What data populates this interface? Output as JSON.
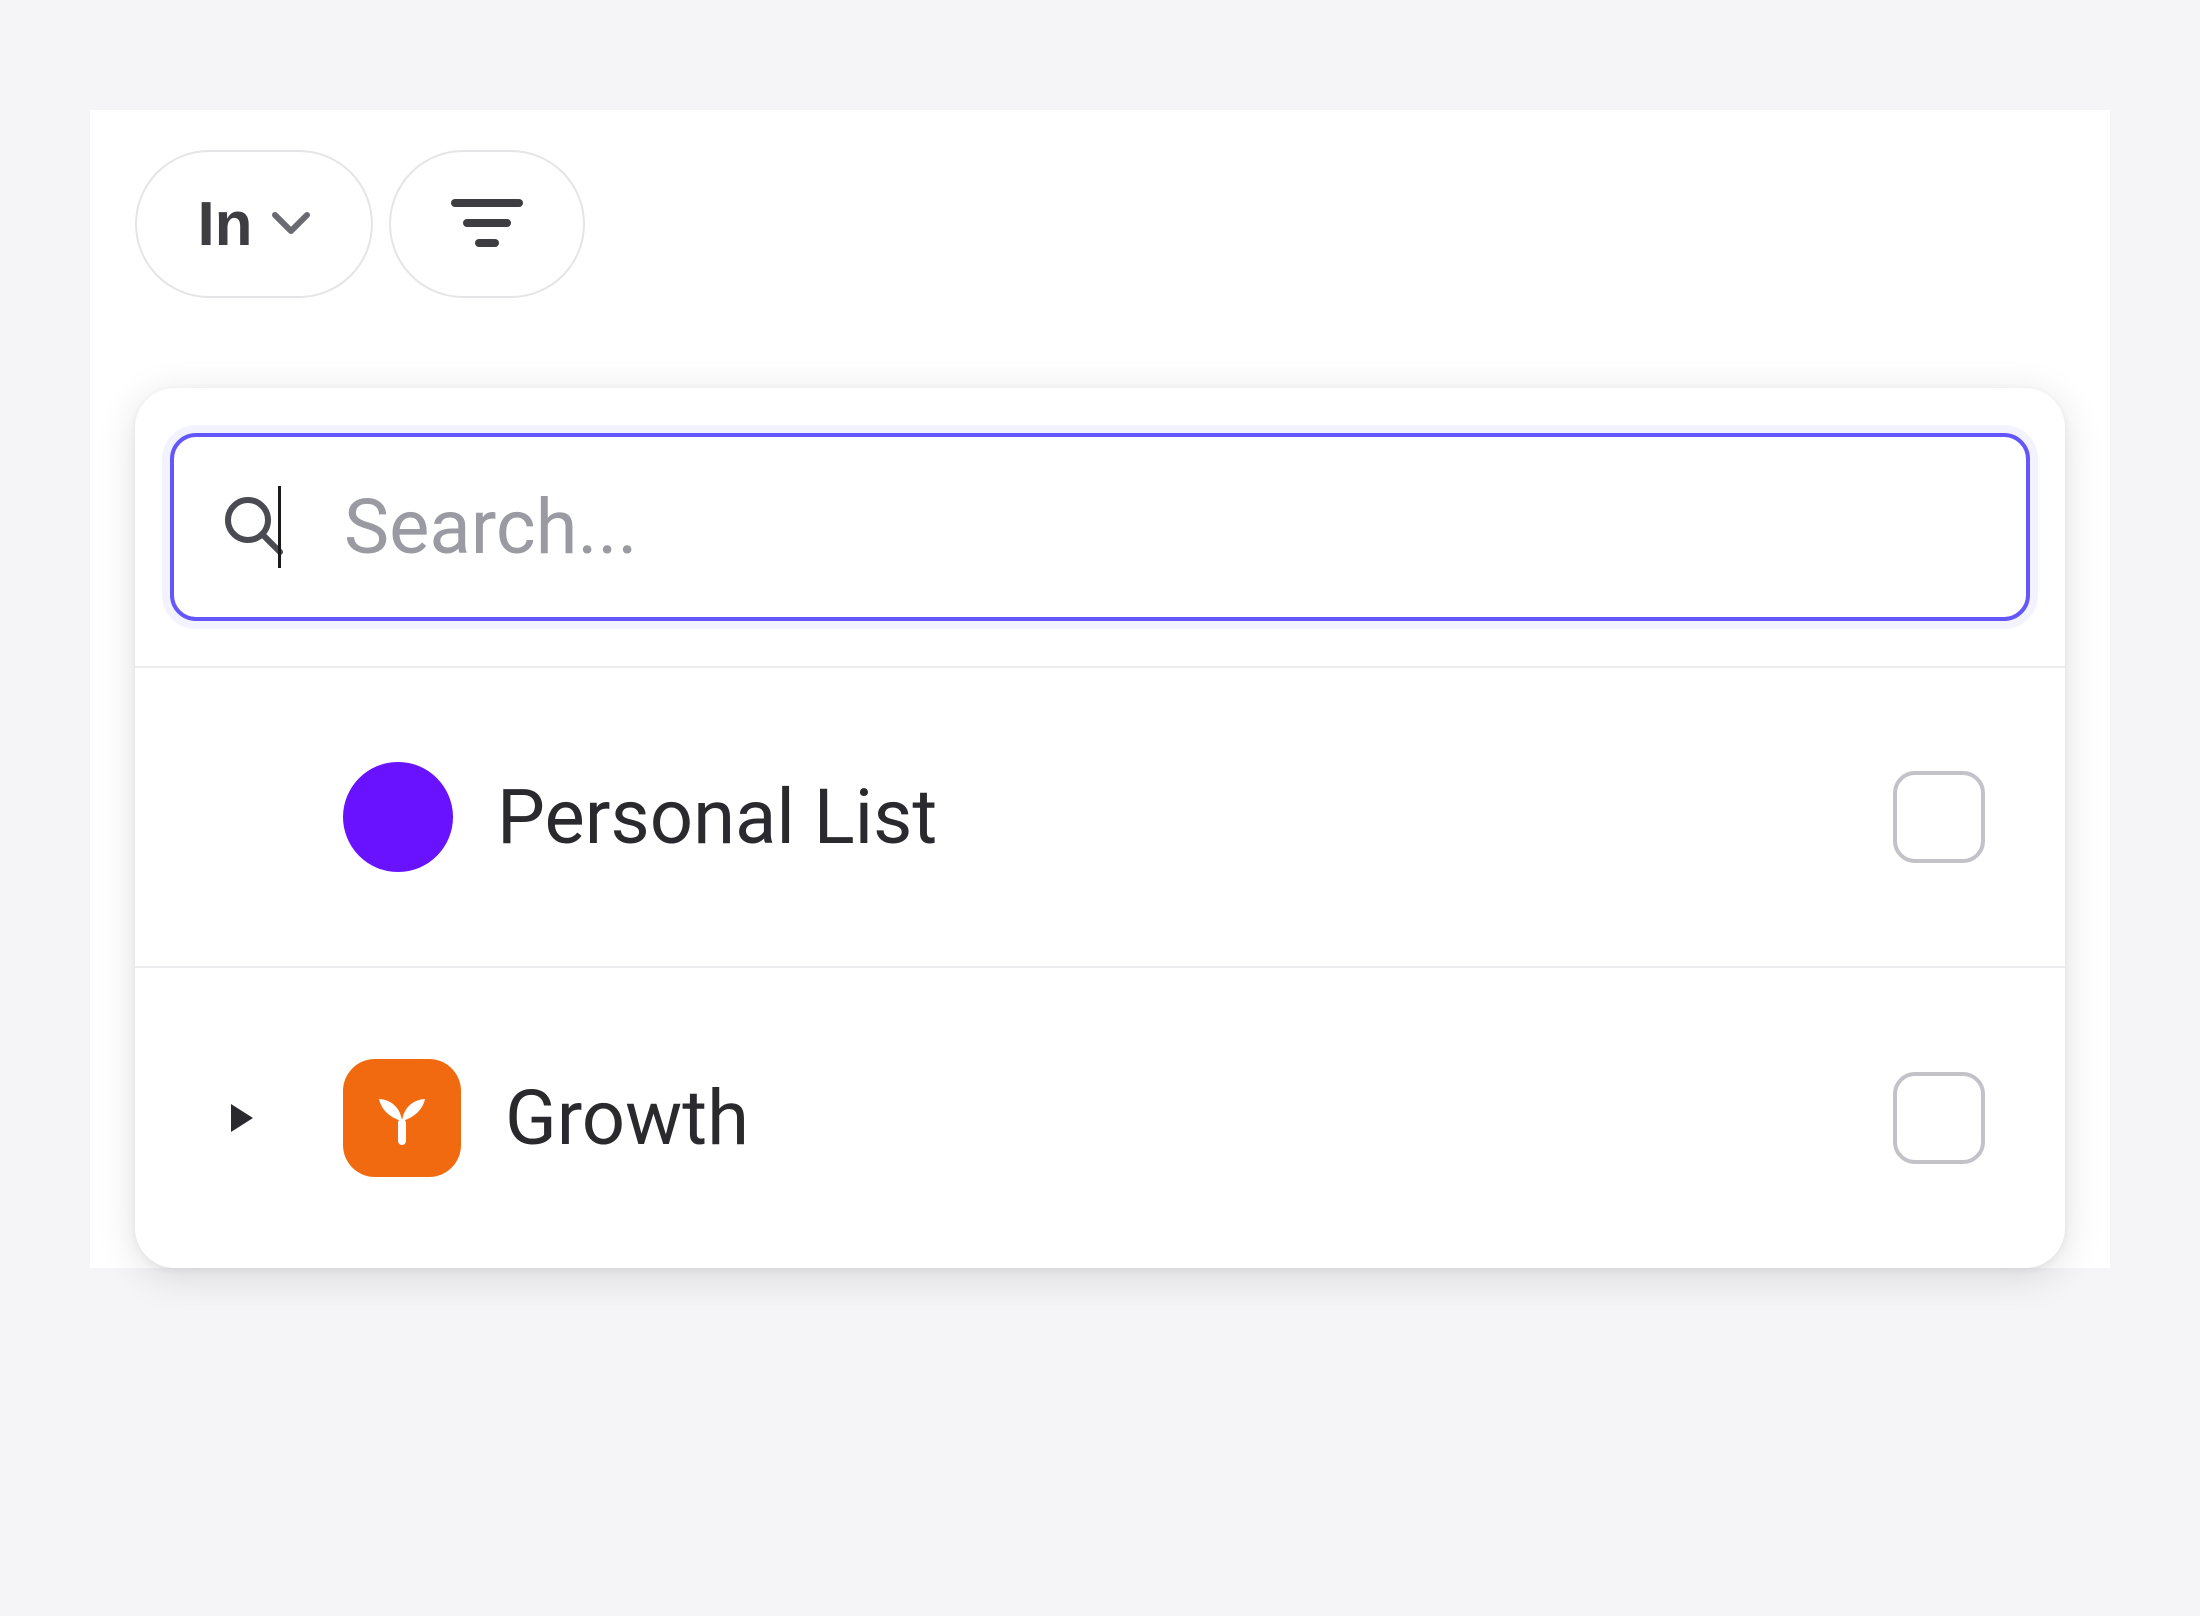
{
  "top": {
    "in_button_label": "In",
    "in_button_icon": "chevron-down",
    "filter_button_icon": "filter"
  },
  "search": {
    "icon": "search",
    "placeholder": "Search...",
    "value": ""
  },
  "items": [
    {
      "icon_type": "circle",
      "icon_color": "#6812ff",
      "label": "Personal List",
      "expandable": false,
      "checked": false
    },
    {
      "icon_type": "plant",
      "icon_color": "#f26a0f",
      "label": "Growth",
      "expandable": true,
      "checked": false
    }
  ]
}
